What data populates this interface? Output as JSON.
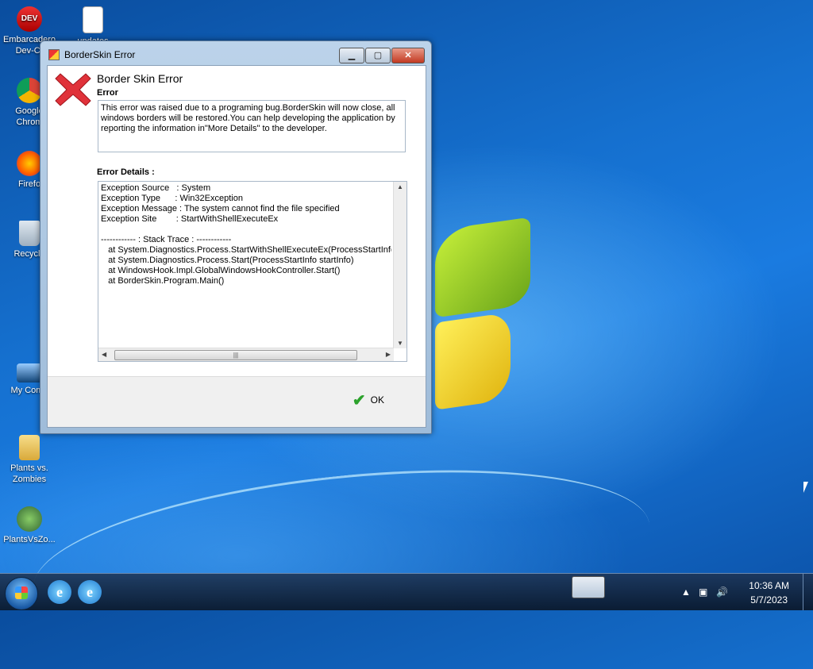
{
  "desktop": {
    "icons": [
      {
        "id": "devcpp",
        "label": "Embarcadero Dev-C-",
        "badge": "DEV"
      },
      {
        "id": "updates",
        "label": "updates"
      },
      {
        "id": "chrome",
        "label": "Google Chrom"
      },
      {
        "id": "firefox",
        "label": "Firefo"
      },
      {
        "id": "recycle",
        "label": "Recycle"
      },
      {
        "id": "computer",
        "label": "My Comp"
      },
      {
        "id": "pvz-folder",
        "label": "Plants vs. Zombies"
      },
      {
        "id": "pvz-game",
        "label": "PlantsVsZo..."
      }
    ]
  },
  "window": {
    "title": "BorderSkin Error",
    "controls": {
      "minimize": "▁",
      "maximize": "▢",
      "close": "✕"
    },
    "heading": "Border Skin Error",
    "error_label": "Error",
    "error_message": "This error was raised due to a programing bug.BorderSkin will now close, all windows borders will be restored.You can help developing the application by reporting the information in\"More Details\" to the developer.",
    "details_label": "Error Details :",
    "details_text": "Exception Source   : System\nException Type      : Win32Exception\nException Message : The system cannot find the file specified\nException Site        : StartWithShellExecuteEx\n\n------------ : Stack Trace : ------------\n   at System.Diagnostics.Process.StartWithShellExecuteEx(ProcessStartInfo st\n   at System.Diagnostics.Process.Start(ProcessStartInfo startInfo)\n   at WindowsHook.Impl.GlobalWindowsHookController.Start()\n   at BorderSkin.Program.Main()",
    "ok_label": "OK"
  },
  "taskbar": {
    "time": "10:36 AM",
    "date": "5/7/2023"
  }
}
